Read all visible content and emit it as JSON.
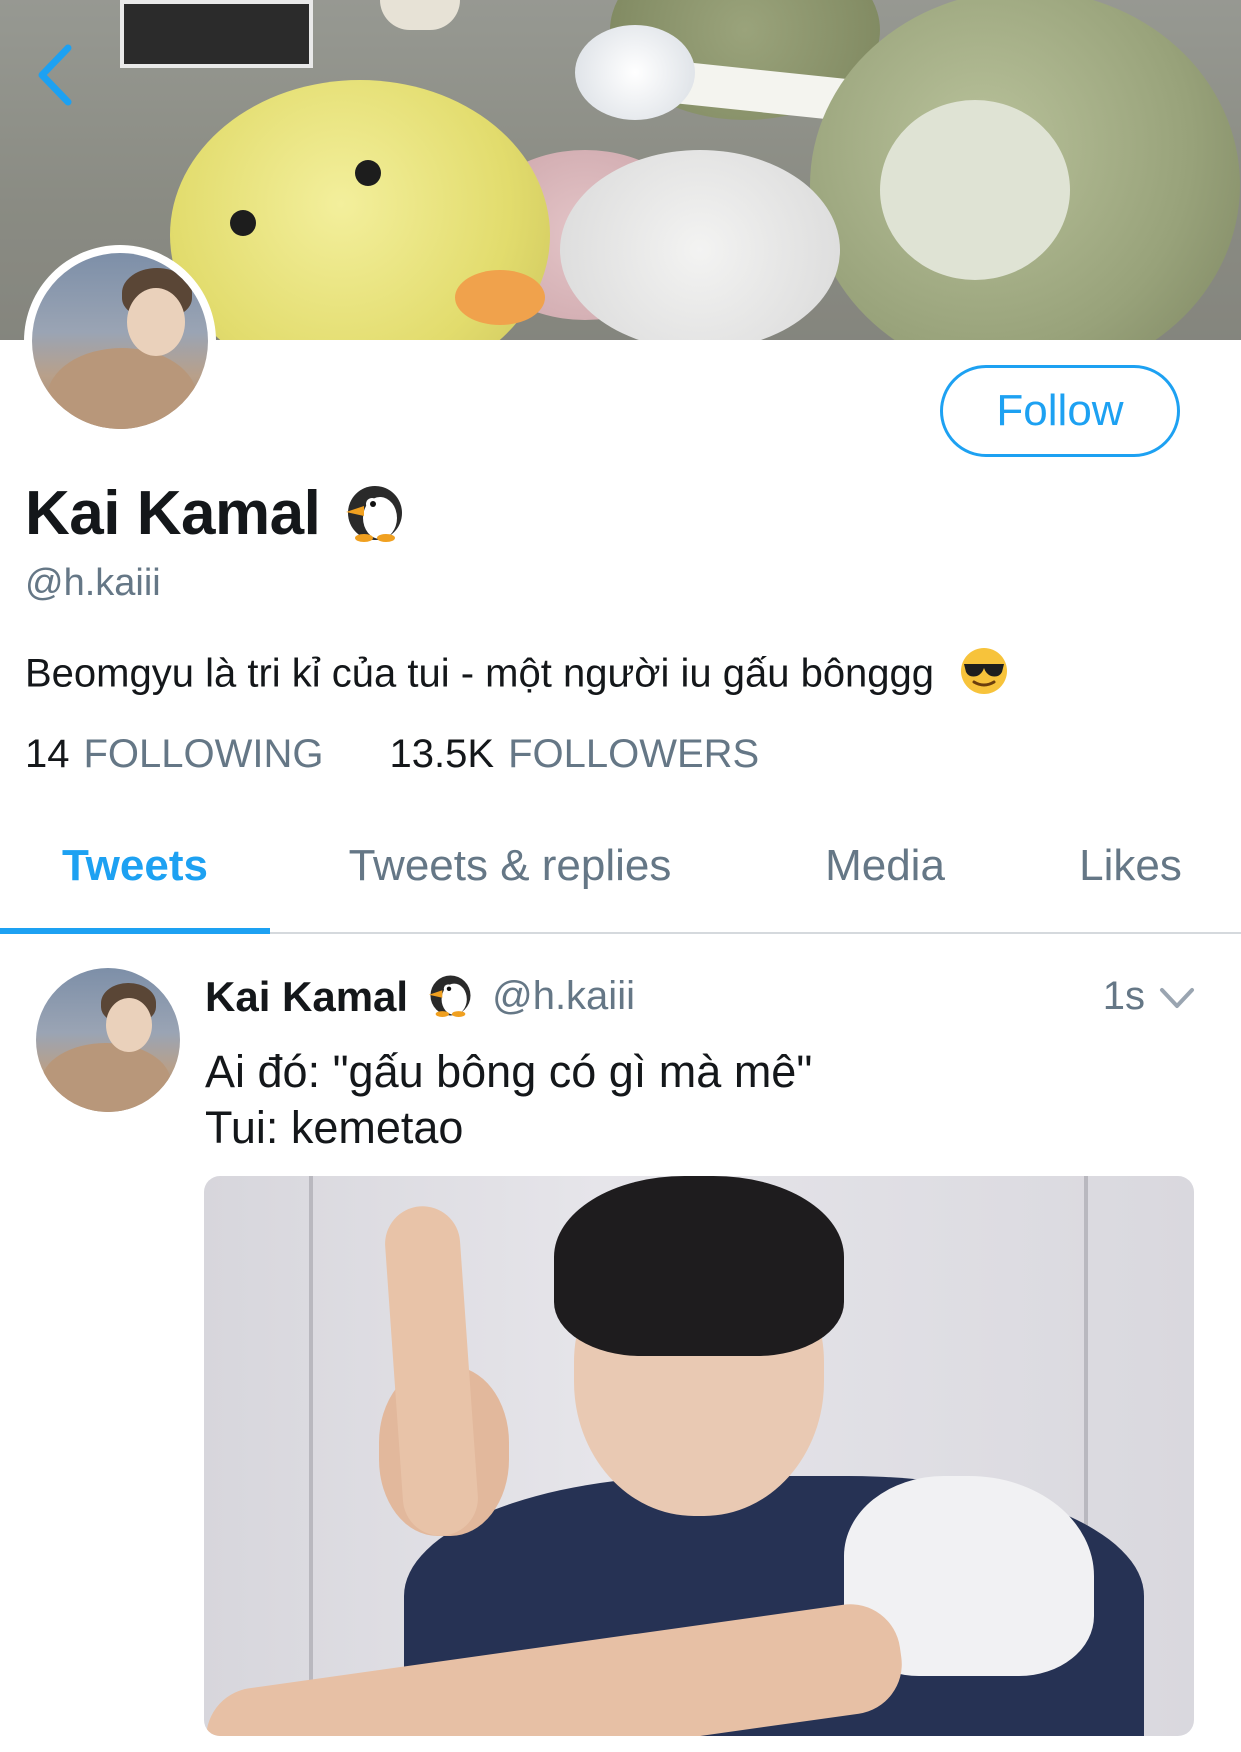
{
  "profile": {
    "name": "Kai Kamal",
    "handle": "@h.kaiii",
    "bio": "Beomgyu là tri kỉ của tui - một người iu gấu bônggg",
    "follow_label": "Follow",
    "following_count": "14",
    "following_label": "FOLLOWING",
    "followers_count": "13.5K",
    "followers_label": "FOLLOWERS",
    "name_emoji": "penguin-icon",
    "bio_emoji": "sunglasses-face-icon"
  },
  "tabs": [
    {
      "label": "Tweets",
      "active": true
    },
    {
      "label": "Tweets & replies",
      "active": false
    },
    {
      "label": "Media",
      "active": false
    },
    {
      "label": "Likes",
      "active": false
    }
  ],
  "tweet": {
    "name": "Kai Kamal",
    "handle": "@h.kaiii",
    "time": "1s",
    "text": "Ai đó: \"gấu bông có gì mà mê\"\nTui: kemetao"
  },
  "colors": {
    "accent": "#1da1f2",
    "secondary_text": "#657786",
    "primary_text": "#14171a"
  }
}
